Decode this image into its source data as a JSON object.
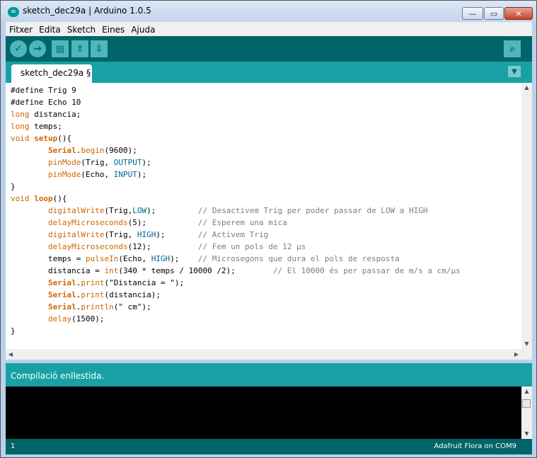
{
  "window": {
    "title": "sketch_dec29a | Arduino 1.0.5",
    "app_icon": "∞",
    "controls": {
      "minimize": "—",
      "maximize": "▭",
      "close": "✕"
    }
  },
  "menu": [
    "Fitxer",
    "Edita",
    "Sketch",
    "Eines",
    "Ajuda"
  ],
  "toolbar": {
    "verify_icon": "✓",
    "upload_icon": "→",
    "new_icon": "▤",
    "open_icon": "⇧",
    "save_icon": "⇩",
    "serial_monitor_icon": "⌕"
  },
  "tabs": {
    "active_label": "sketch_dec29a §",
    "menu_icon": "▼"
  },
  "editor": {
    "language": "arduino",
    "code_lines": [
      "#define Trig 9",
      "#define Echo 10",
      "long distancia;",
      "long temps;",
      "void setup(){",
      "        Serial.begin(9600);",
      "        pinMode(Trig, OUTPUT);",
      "        pinMode(Echo, INPUT);",
      "}",
      "void loop(){",
      "        digitalWrite(Trig,LOW);         // Desactivem Trig per poder passar de LOW a HIGH",
      "        delayMicroseconds(5);           // Esperem una mica",
      "        digitalWrite(Trig, HIGH);       // Activem Trig",
      "        delayMicroseconds(12);          // Fem un pols de 12 µs",
      "        temps = pulseIn(Echo, HIGH);    // Microsegons que dura el pols de resposta",
      "        distancia = int(340 * temps / 10000 /2);        // El 10000 és per passar de m/s a cm/µs",
      "        Serial.print(\"Distancia = \");",
      "        Serial.print(distancia);",
      "        Serial.println(\" cm\");",
      "        delay(1500);",
      "}"
    ]
  },
  "status": {
    "message": "Compilació enllestida."
  },
  "console": {
    "text": ""
  },
  "footer": {
    "line_number": "1",
    "board": "Adafruit Flora on COM9"
  },
  "colors": {
    "toolbar_bg": "#006468",
    "tab_bar_bg": "#17a1a5",
    "keyword": "#cc6600",
    "constant": "#006699",
    "comment": "#7e7e7e"
  }
}
